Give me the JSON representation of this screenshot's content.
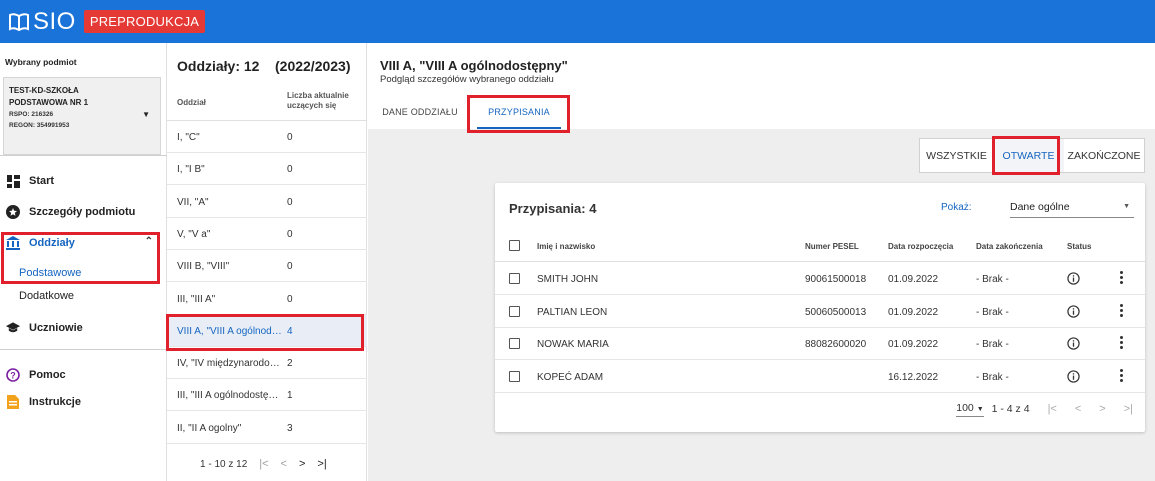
{
  "header": {
    "app_name": "SIO",
    "env_badge": "PREPRODUKCJA",
    "colors": {
      "bar": "#1a73d9",
      "badge": "#e53935",
      "accent": "#1565c0",
      "highlight": "#e0202a"
    }
  },
  "sidebar": {
    "caption": "Wybrany podmiot",
    "entity": {
      "name": "TEST-KD-SZKOŁA PODSTAWOWA NR 1",
      "rspo": "RSPO: 216326",
      "regon": "REGON: 354991953"
    },
    "nav": {
      "start": "Start",
      "details": "Szczegóły podmiotu",
      "classes": "Oddziały",
      "classes_basic": "Podstawowe",
      "classes_extra": "Dodatkowe",
      "students": "Uczniowie",
      "help": "Pomoc",
      "instructions": "Instrukcje"
    }
  },
  "classlist": {
    "title": "Oddziały: 12",
    "year": "(2022/2023)",
    "col_name": "Oddział",
    "col_count": "Liczba aktualnie uczących się",
    "rows": [
      {
        "name": "I, \"C\"",
        "count": "0"
      },
      {
        "name": "I, \"I B\"",
        "count": "0"
      },
      {
        "name": "VII, \"A\"",
        "count": "0"
      },
      {
        "name": "V, \"V a\"",
        "count": "0"
      },
      {
        "name": "VIII B, \"VIII\"",
        "count": "0"
      },
      {
        "name": "III, \"III A\"",
        "count": "0"
      },
      {
        "name": "VIII A, \"VIII A ogólnodostępny\"",
        "count": "4"
      },
      {
        "name": "IV, \"IV międzynarodowy\"",
        "count": "2"
      },
      {
        "name": "III, \"III A ogólnodostępny\"",
        "count": "1"
      },
      {
        "name": "II, \"II A ogolny\"",
        "count": "3"
      }
    ],
    "pager": "1 - 10 z 12"
  },
  "detail": {
    "title": "VIII A, \"VIII A ogólnodostępny\"",
    "subtitle": "Podgląd szczegółów wybranego oddziału",
    "tabs": {
      "data": "DANE ODDZIAŁU",
      "assign": "PRZYPISANIA"
    },
    "filters": {
      "all": "WSZYSTKIE",
      "open": "OTWARTE",
      "closed": "ZAKOŃCZONE"
    },
    "card": {
      "title": "Przypisania: 4",
      "show_label": "Pokaż:",
      "show_value": "Dane ogólne",
      "columns": {
        "name": "Imię i nazwisko",
        "pesel": "Numer PESEL",
        "start": "Data rozpoczęcia",
        "end": "Data zakończenia",
        "status": "Status"
      },
      "rows": [
        {
          "name": "SMITH JOHN",
          "pesel": "90061500018",
          "start": "01.09.2022",
          "end": "- Brak -"
        },
        {
          "name": "PALTIAN LEON",
          "pesel": "50060500013",
          "start": "01.09.2022",
          "end": "- Brak -"
        },
        {
          "name": "NOWAK MARIA",
          "pesel": "88082600020",
          "start": "01.09.2022",
          "end": "- Brak -"
        },
        {
          "name": "KOPEĆ ADAM",
          "pesel": "",
          "start": "16.12.2022",
          "end": "- Brak -"
        }
      ],
      "per_page": "100",
      "range": "1 - 4 z 4"
    }
  }
}
